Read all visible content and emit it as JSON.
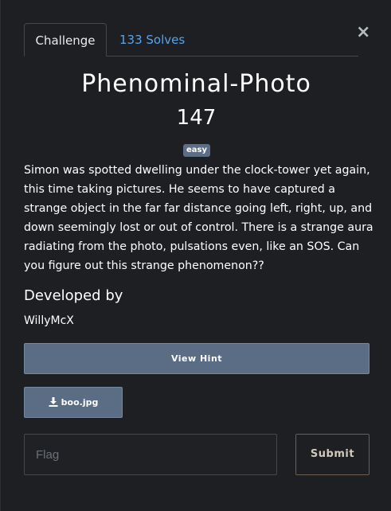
{
  "tabs": {
    "challenge": "Challenge",
    "solves": "133 Solves"
  },
  "close_icon": "×",
  "challenge": {
    "name": "Phenominal-Photo",
    "points": "147",
    "difficulty": "easy",
    "description": "Simon was spotted dwelling under the clock-tower yet again, this time taking pictures. He seems to have captured a strange object in the far far distance going left, right, up, and down seemingly lost or out of control. There is a strange aura radiating from the photo, pulsations even, like an SOS. Can you figure out this strange phenomenon??"
  },
  "developer": {
    "heading": "Developed by",
    "name": "WillyMcX"
  },
  "hint_button": "View Hint",
  "file": {
    "icon": "download-icon",
    "name": "boo.jpg"
  },
  "flag": {
    "placeholder": "Flag",
    "value": ""
  },
  "submit_label": "Submit",
  "colors": {
    "background": "#1d1f22",
    "link": "#5aa3e6",
    "button": "#5a6d84",
    "badge": "#5b6e85"
  }
}
